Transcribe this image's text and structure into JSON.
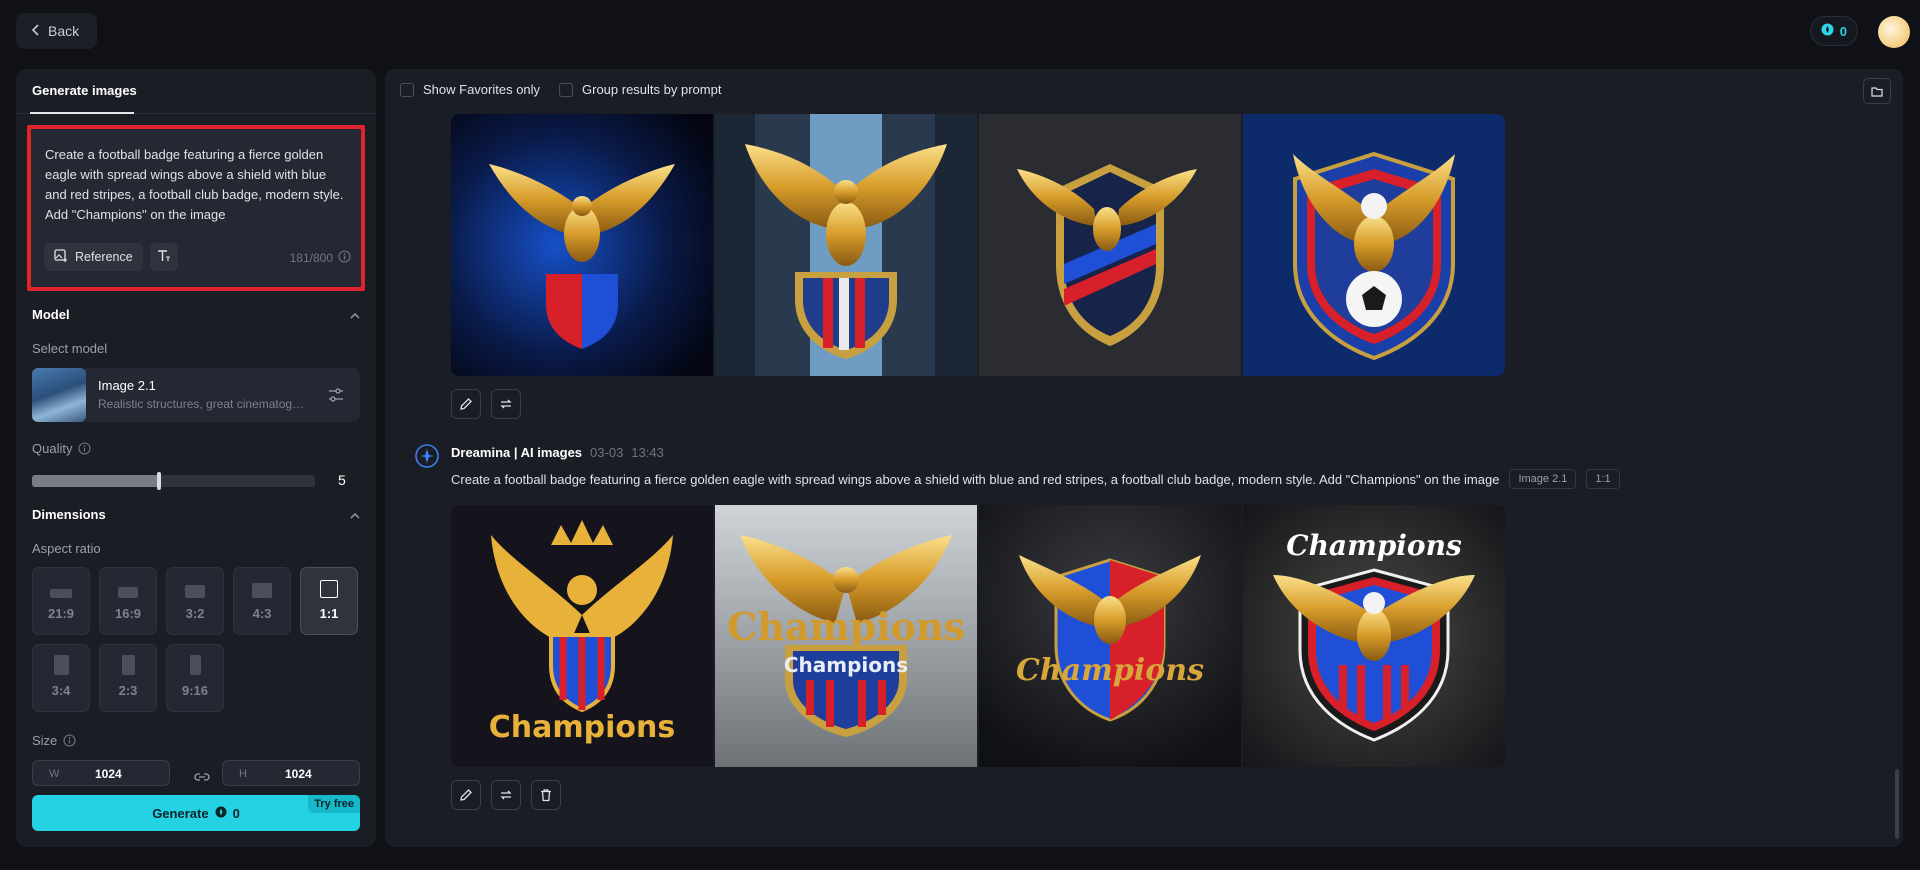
{
  "topbar": {
    "back_label": "Back",
    "credits": "0"
  },
  "sidebar": {
    "tab_label": "Generate images",
    "prompt": "Create a football badge featuring a fierce golden eagle with spread wings above a shield with blue and red stripes, a football club badge, modern style. Add \"Champions\" on the image",
    "reference_label": "Reference",
    "char_count": "181/800",
    "model_section": "Model",
    "select_model_label": "Select model",
    "model_name": "Image 2.1",
    "model_desc": "Realistic structures, great cinematography",
    "quality_label": "Quality",
    "quality_value": "5",
    "quality_level": 0.45,
    "dimensions_section": "Dimensions",
    "aspect_label": "Aspect ratio",
    "ratios": [
      "21:9",
      "16:9",
      "3:2",
      "4:3",
      "1:1",
      "3:4",
      "2:3",
      "9:16"
    ],
    "selected_ratio": "1:1",
    "size_label": "Size",
    "width_label": "W",
    "width_value": "1024",
    "height_label": "H",
    "height_value": "1024",
    "generate_label": "Generate",
    "generate_cost": "0",
    "try_free_label": "Try free"
  },
  "main": {
    "filter_favorites": "Show Favorites only",
    "filter_group": "Group results by prompt",
    "group": {
      "name": "Dreamina | AI images",
      "date": "03-03",
      "time": "13:43",
      "prompt": "Create a football badge featuring a fierce golden eagle with spread wings above a shield with blue and red stripes, a football club badge, modern style. Add \"Champions\" on the image",
      "model_tag": "Image 2.1",
      "ratio_tag": "1:1"
    },
    "badge_text": "Champions"
  },
  "colors": {
    "accent": "#25d2e3",
    "highlight_border": "#e0242b",
    "gold": "#e8b23a",
    "blue": "#1f4fd6",
    "red": "#d8202a"
  }
}
